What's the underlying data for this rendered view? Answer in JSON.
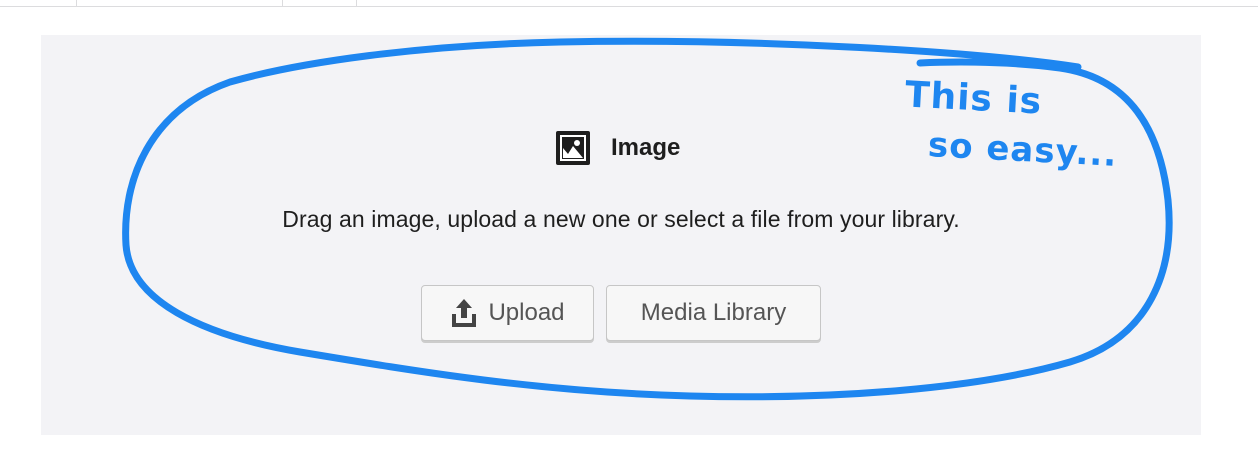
{
  "toolbar": {
    "separators": 4
  },
  "block": {
    "title": "Image",
    "icon": "image-icon",
    "instructions": "Drag an image, upload a new one or select a file from your library."
  },
  "buttons": {
    "upload_label": "Upload",
    "upload_icon": "upload-icon",
    "media_library_label": "Media Library"
  },
  "annotation": {
    "line1": "This is",
    "line2": "so easy...",
    "color": "#1e86f0"
  },
  "colors": {
    "placeholder_bg": "#f3f3f6",
    "text": "#1e1e1e",
    "button_text": "#555555",
    "annotation_blue": "#1e86f0"
  }
}
